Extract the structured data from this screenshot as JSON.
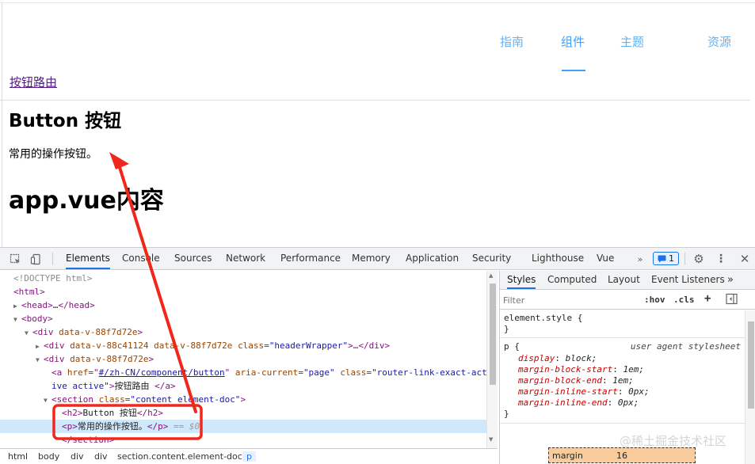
{
  "page": {
    "nav": [
      {
        "label": "指南",
        "active": false
      },
      {
        "label": "组件",
        "active": true
      },
      {
        "label": "主题",
        "active": false
      },
      {
        "label": "资源",
        "active": false
      }
    ],
    "route_link": "按钮路由",
    "h2": "Button 按钮",
    "paragraph": "常用的操作按钮。",
    "h1": "app.vue内容"
  },
  "devtools": {
    "tabs": [
      "Elements",
      "Console",
      "Sources",
      "Network",
      "Performance",
      "Memory",
      "Application",
      "Security",
      "Lighthouse",
      "Vue"
    ],
    "active_tab": "Elements",
    "issues_count": "1",
    "dom": {
      "l0": "<!DOCTYPE html>",
      "l1": "<html>",
      "l2": {
        "open": "<head>",
        "mid": "…",
        "close": "</head>"
      },
      "l3": "<body>",
      "l4": {
        "tag": "<div",
        "attr": "data-v-88f7d72e",
        "end": ">"
      },
      "l5": {
        "tag": "<div",
        "a1": "data-v-88c41124",
        "a2": "data-v-88f7d72e",
        "a3n": "class",
        "a3v": "\"headerWrapper\"",
        "end": ">…</div>"
      },
      "l6": {
        "tag": "<div",
        "attr": "data-v-88f7d72e",
        "end": ">"
      },
      "l7": {
        "tag": "<a",
        "hrefn": "href",
        "hrefv": "#/zh-CN/component/button",
        "arian": "aria-current",
        "ariav": "\"page\"",
        "classn": "class",
        "classv": "\"router-link-exact-act"
      },
      "l8": {
        "cont": "ive active\"",
        "end": ">",
        "text": "按钮路由 ",
        "close": "</a>"
      },
      "l9": {
        "tag": "<section",
        "classn": "class",
        "classv": "\"content element-doc\"",
        "end": ">"
      },
      "l10": {
        "open": "<h2>",
        "text": "Button 按钮",
        "close": "</h2>"
      },
      "l11": {
        "open": "<p>",
        "text": "常用的操作按钮。",
        "close": "</p>",
        "marker": "== $0"
      },
      "l12": "</section>"
    },
    "breadcrumb": [
      "html",
      "body",
      "div",
      "div",
      "section.content.element-doc",
      "p"
    ],
    "styles_tabs": [
      "Styles",
      "Computed",
      "Layout",
      "Event Listeners"
    ],
    "styles_more": "»",
    "filter_placeholder": "Filter",
    "hov_label": ":hov",
    "cls_label": ".cls",
    "element_style": {
      "selector": "element.style {",
      "close": "}"
    },
    "ua_rule": {
      "selector": "p {",
      "source": "user agent stylesheet",
      "props": [
        {
          "name": "display",
          "value": "block;"
        },
        {
          "name": "margin-block-start",
          "value": "1em;"
        },
        {
          "name": "margin-block-end",
          "value": "1em;"
        },
        {
          "name": "margin-inline-start",
          "value": "0px;"
        },
        {
          "name": "margin-inline-end",
          "value": "0px;"
        }
      ],
      "close": "}"
    },
    "box_model": {
      "label": "margin",
      "value": "16"
    }
  },
  "watermark": "@稀土掘金技术社区",
  "colors": {
    "accent": "#409eff",
    "devtools_blue": "#1a73e8",
    "annotation_red": "#f0271b"
  }
}
